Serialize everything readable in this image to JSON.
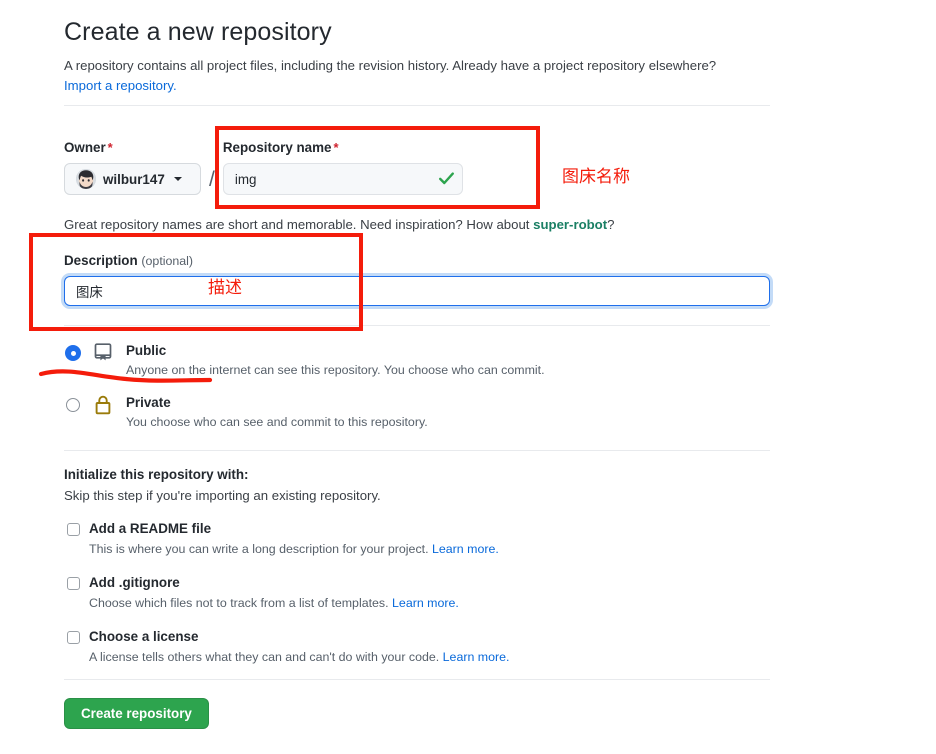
{
  "header": {
    "title": "Create a new repository",
    "subtitle": "A repository contains all project files, including the revision history. Already have a project repository elsewhere?",
    "import_link": "Import a repository."
  },
  "owner": {
    "label": "Owner",
    "required_mark": "*",
    "username": "wilbur147",
    "separator": "/",
    "avatar_icon": "user-avatar"
  },
  "repository_name": {
    "label": "Repository name",
    "required_mark": "*",
    "value": "img",
    "placeholder": "",
    "validation_icon": "green-check-icon"
  },
  "hint": {
    "prefix": "Great repository names are short and memorable. Need inspiration? How about ",
    "suggestion": "super-robot",
    "suffix": "?"
  },
  "description": {
    "label": "Description",
    "optional_label": "(optional)",
    "value": "图床",
    "placeholder": ""
  },
  "visibility": {
    "options": [
      {
        "id": "public",
        "title": "Public",
        "description": "Anyone on the internet can see this repository. You choose who can commit.",
        "icon": "repo-book-icon",
        "selected": true
      },
      {
        "id": "private",
        "title": "Private",
        "description": "You choose who can see and commit to this repository.",
        "icon": "lock-icon",
        "selected": false
      }
    ]
  },
  "initialize": {
    "title": "Initialize this repository with:",
    "subtitle": "Skip this step if you're importing an existing repository.",
    "items": [
      {
        "id": "readme",
        "label": "Add a README file",
        "description": "This is where you can write a long description for your project.",
        "learn_more": "Learn more.",
        "checked": false
      },
      {
        "id": "gitignore",
        "label": "Add .gitignore",
        "description": "Choose which files not to track from a list of templates.",
        "learn_more": "Learn more.",
        "checked": false
      },
      {
        "id": "license",
        "label": "Choose a license",
        "description": "A license tells others what they can and can't do with your code.",
        "learn_more": "Learn more.",
        "checked": false
      }
    ]
  },
  "submit": {
    "label": "Create repository"
  },
  "annotations": {
    "repo_name_note": "图床名称",
    "description_note": "描述",
    "box_color": "#f41c0b",
    "underline_color": "#f41c0b"
  },
  "colors": {
    "link": "#0969da",
    "suggestion": "#1a7f64",
    "submit_green": "#2da44e",
    "required_red": "#cf222e",
    "annotation_red": "#f41c0b",
    "focus_blue": "#1f6feb",
    "lock_yellow": "#9a7b0a"
  }
}
